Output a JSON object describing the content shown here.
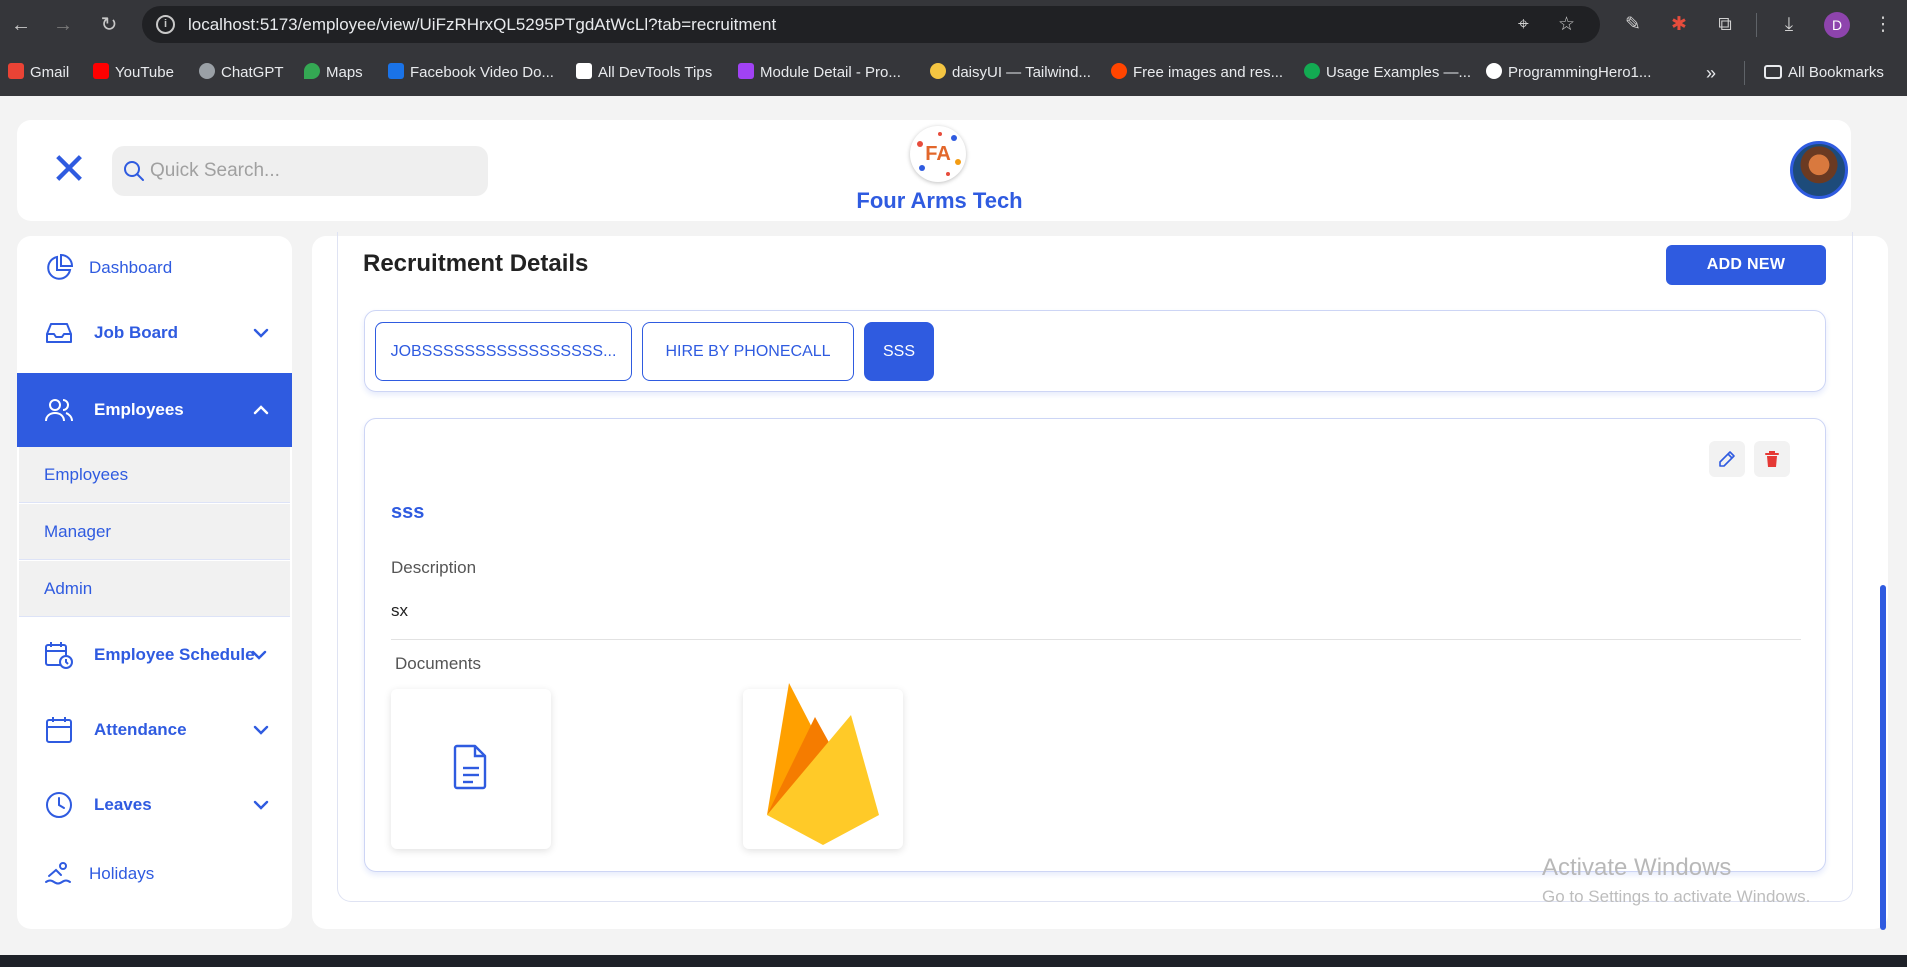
{
  "browser": {
    "url": "localhost:5173/employee/view/UiFzRHrxQL5295PTgdAtWcLl?tab=recruitment",
    "profile_initial": "D",
    "bookmarks": [
      {
        "label": "Gmail",
        "color": "#ea4335"
      },
      {
        "label": "YouTube",
        "color": "#ff0000"
      },
      {
        "label": "ChatGPT",
        "color": "#9aa0a6"
      },
      {
        "label": "Maps",
        "color": "#34a853"
      },
      {
        "label": "Facebook Video Do...",
        "color": "#1a73e8"
      },
      {
        "label": "All DevTools Tips",
        "color": "#ffffff"
      },
      {
        "label": "Module Detail - Pro...",
        "color": "#a142f4"
      },
      {
        "label": "daisyUI — Tailwind...",
        "color": "#f4c542"
      },
      {
        "label": "Free images and res...",
        "color": "#ff4500"
      },
      {
        "label": "Usage Examples —...",
        "color": "#13aa52"
      },
      {
        "label": "ProgrammingHero1...",
        "color": "#ffffff"
      }
    ],
    "all_bookmarks": "All Bookmarks"
  },
  "header": {
    "search_placeholder": "Quick Search...",
    "brand": "Four Arms Tech",
    "logo_text": "FA"
  },
  "sidebar": {
    "items": [
      {
        "label": "Dashboard",
        "icon": "pie-chart-icon"
      },
      {
        "label": "Job Board",
        "icon": "inbox-icon"
      },
      {
        "label": "Employees",
        "icon": "users-icon"
      },
      {
        "label": "Employee Schedule",
        "icon": "calendar-clock-icon"
      },
      {
        "label": "Attendance",
        "icon": "calendar-icon"
      },
      {
        "label": "Leaves",
        "icon": "clock-icon"
      },
      {
        "label": "Holidays",
        "icon": "swimmer-icon"
      }
    ],
    "sub_items": [
      "Employees",
      "Manager",
      "Admin"
    ]
  },
  "main": {
    "title": "Recruitment Details",
    "add_button": "ADD NEW",
    "tabs": [
      "JOBSSSSSSSSSSSSSSSSS...",
      "HIRE BY PHONECALL",
      "SSS"
    ],
    "card": {
      "title": "sss",
      "description_label": "Description",
      "description_value": "sx",
      "documents_label": "Documents"
    }
  },
  "os": {
    "watermark_title": "Activate Windows",
    "watermark_sub": "Go to Settings to activate Windows."
  },
  "colors": {
    "accent": "#2f5be0",
    "danger": "#e53935"
  }
}
